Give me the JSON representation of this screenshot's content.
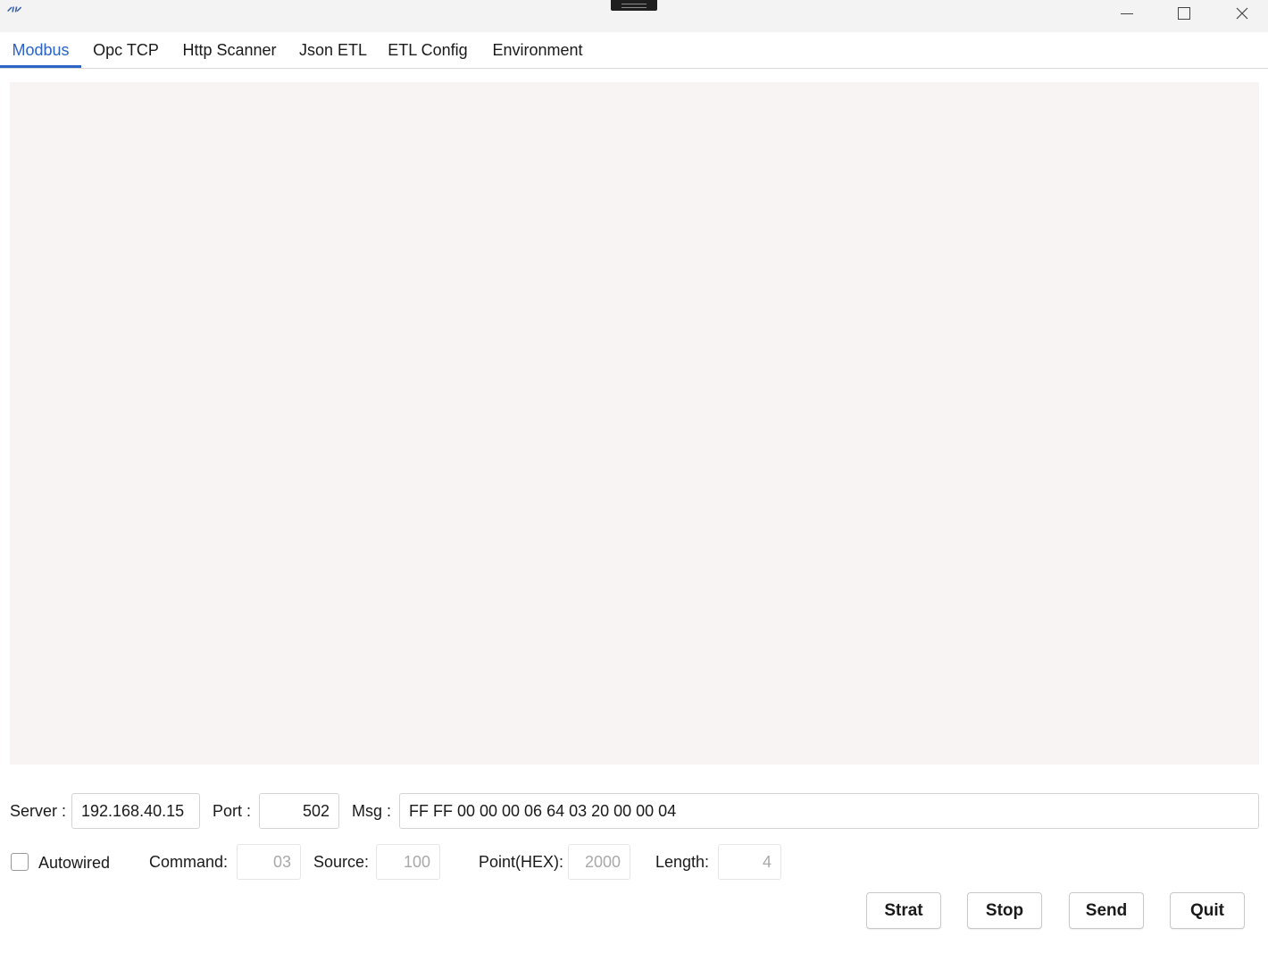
{
  "window": {
    "logo_text": "𝄍"
  },
  "tabs": [
    {
      "label": "Modbus",
      "active": true
    },
    {
      "label": "Opc TCP",
      "active": false
    },
    {
      "label": "Http Scanner",
      "active": false
    },
    {
      "label": "Json ETL",
      "active": false
    },
    {
      "label": "ETL Config",
      "active": false
    },
    {
      "label": "Environment",
      "active": false
    }
  ],
  "connection": {
    "server_label": "Server :",
    "server_value": "192.168.40.15",
    "port_label": "Port :",
    "port_value": "502",
    "msg_label": "Msg :",
    "msg_value": "FF FF 00 00 00 06 64 03 20 00 00 04"
  },
  "params": {
    "autowired_label": "Autowired",
    "command_label": "Command:",
    "command_value": "03",
    "source_label": "Source:",
    "source_value": "100",
    "point_label": "Point(HEX):",
    "point_value": "2000",
    "length_label": "Length:",
    "length_value": "4"
  },
  "actions": {
    "start_label": "Strat",
    "stop_label": "Stop",
    "send_label": "Send",
    "quit_label": "Quit"
  },
  "colors": {
    "accent": "#2b63c7",
    "log_background": "#f8f4f3"
  }
}
